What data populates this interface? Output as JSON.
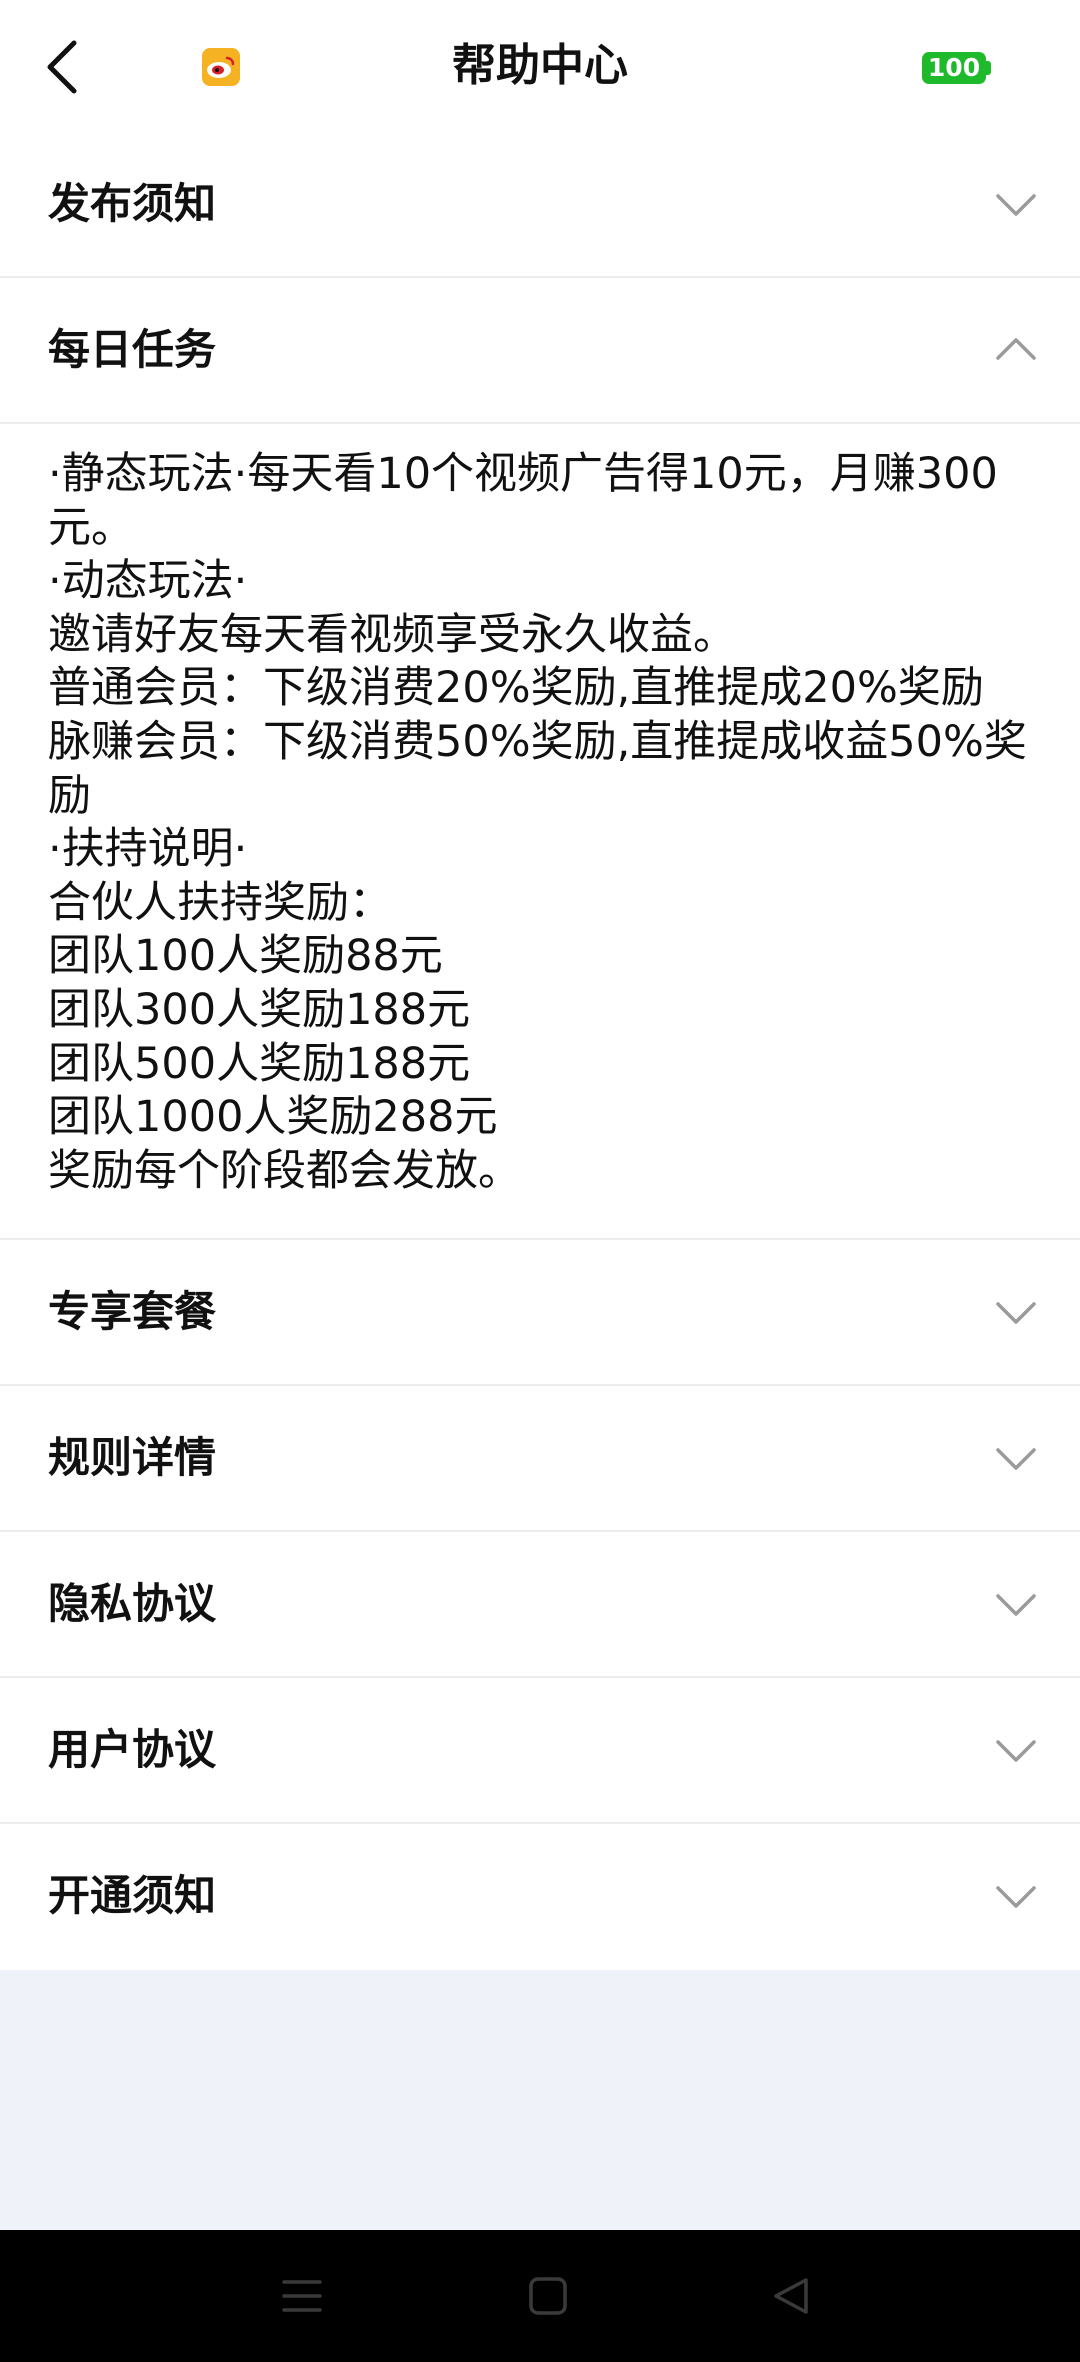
{
  "header": {
    "title": "帮助中心",
    "battery_level": "100",
    "icons": [
      "back-icon",
      "weibo-icon"
    ]
  },
  "sections": [
    {
      "title": "发布须知",
      "expanded": false
    },
    {
      "title": "每日任务",
      "expanded": true,
      "content": [
        "·静态玩法·每天看10个视频广告得10元，月赚300元。",
        "·动态玩法·",
        "邀请好友每天看视频享受永久收益。",
        "普通会员：下级消费20%奖励,直推提成20%奖励",
        "脉赚会员：下级消费50%奖励,直推提成收益50%奖励",
        "·扶持说明·",
        "合伙人扶持奖励：",
        "团队100人奖励88元",
        "团队300人奖励188元",
        "团队500人奖励188元",
        "团队1000人奖励288元",
        "奖励每个阶段都会发放。"
      ]
    },
    {
      "title": "专享套餐",
      "expanded": false
    },
    {
      "title": "规则详情",
      "expanded": false
    },
    {
      "title": "隐私协议",
      "expanded": false
    },
    {
      "title": "用户协议",
      "expanded": false
    },
    {
      "title": "开通须知",
      "expanded": false
    }
  ],
  "system_nav": {
    "icons": [
      "menu-icon",
      "home-icon",
      "back-triangle-icon"
    ]
  },
  "colors": {
    "battery": "#1fba2c",
    "page_background": "#eff2f9",
    "chevron": "#9a9a9a"
  }
}
